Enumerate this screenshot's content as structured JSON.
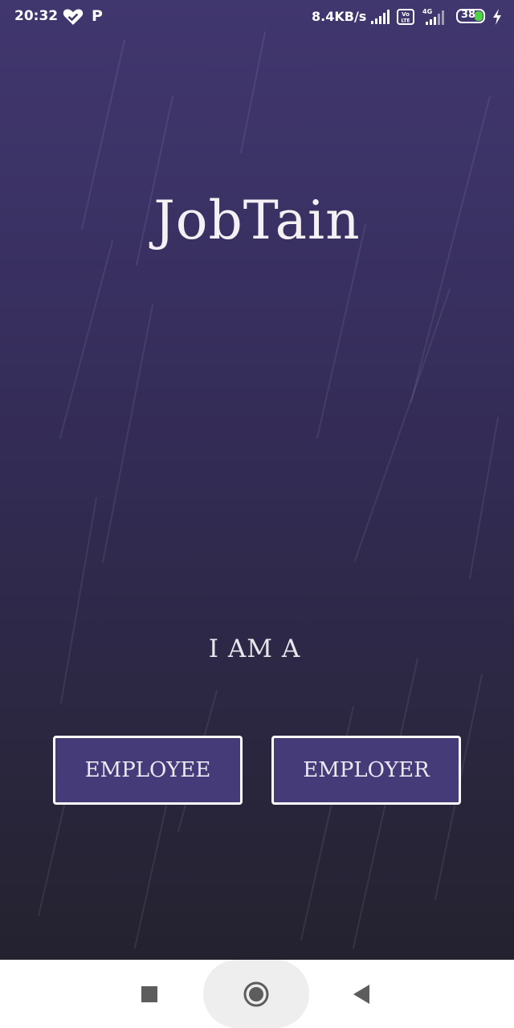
{
  "status_bar": {
    "time": "20:32",
    "network_speed": "8.4KB/s",
    "battery_level": "38",
    "notification_letter": "P",
    "icons": [
      "heart-check-icon",
      "p-notification-icon",
      "signal-icon",
      "volte-icon",
      "4g-signal-icon",
      "battery-icon",
      "charging-bolt-icon"
    ],
    "volte_label": "Vo LTE",
    "network_type": "4G",
    "colors": {
      "text": "#ffffff",
      "battery_fill": "#4fd046"
    }
  },
  "app": {
    "title": "JobTain",
    "role_prompt": "I AM A",
    "buttons": {
      "employee": "EMPLOYEE",
      "employer": "EMPLOYER"
    },
    "colors": {
      "background_top": "#41376f",
      "background_bottom": "#24222f",
      "button_fill": "#463b79",
      "button_border": "#ffffff"
    }
  },
  "nav_bar": {
    "icons": [
      "recents-square-icon",
      "home-circle-icon",
      "back-triangle-icon"
    ]
  }
}
